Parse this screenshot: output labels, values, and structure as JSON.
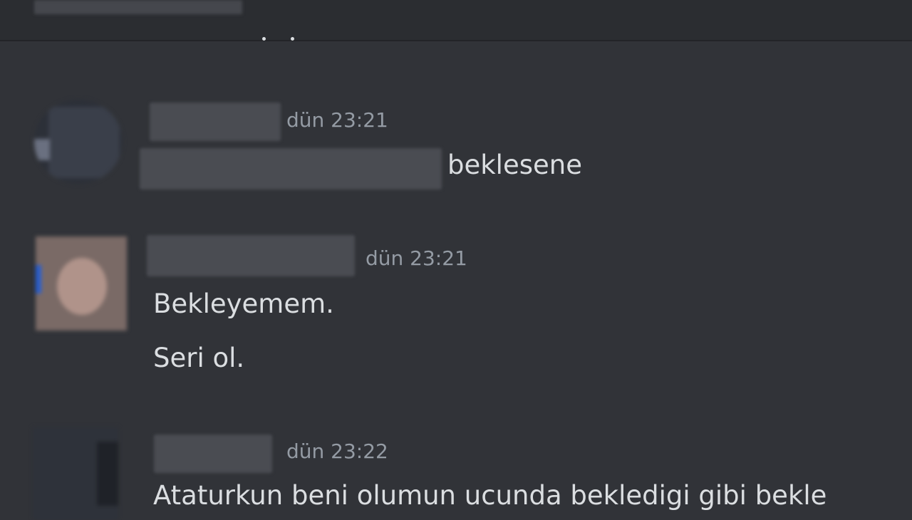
{
  "messages": [
    {
      "timestamp": "dün 23:21",
      "lines": [
        "beklesene"
      ]
    },
    {
      "timestamp": "dün 23:21",
      "lines": [
        "Bekleyemem.",
        "Seri ol."
      ]
    },
    {
      "timestamp": "dün 23:22",
      "lines": [
        "Ataturkun beni olumun ucunda bekledigi gibi bekle"
      ]
    }
  ],
  "colors": {
    "background": "#313338",
    "header_background": "#2b2d31",
    "text": "#dbdee1",
    "timestamp": "#949ba4"
  }
}
